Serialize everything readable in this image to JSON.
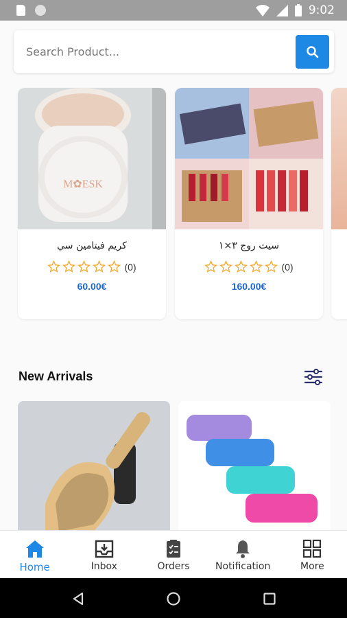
{
  "status_bar": {
    "time": "9:02"
  },
  "search": {
    "placeholder": "Search Product..."
  },
  "featured_products": [
    {
      "name": "كريم فيتامين سي",
      "rating_count": "(0)",
      "price": "60.00€",
      "stars_filled": 0
    },
    {
      "name": "سيت روج ٣×١",
      "rating_count": "(0)",
      "price": "160.00€",
      "stars_filled": 0
    }
  ],
  "section": {
    "title": "New Arrivals"
  },
  "bottom_nav": [
    {
      "label": "Home",
      "icon": "home-icon",
      "active": true
    },
    {
      "label": "Inbox",
      "icon": "inbox-icon",
      "active": false
    },
    {
      "label": "Orders",
      "icon": "clipboard-icon",
      "active": false
    },
    {
      "label": "Notification",
      "icon": "bell-icon",
      "active": false
    },
    {
      "label": "More",
      "icon": "grid-icon",
      "active": false
    }
  ],
  "colors": {
    "accent": "#1e88e5",
    "price": "#1e66d0",
    "star": "#f5a623"
  }
}
